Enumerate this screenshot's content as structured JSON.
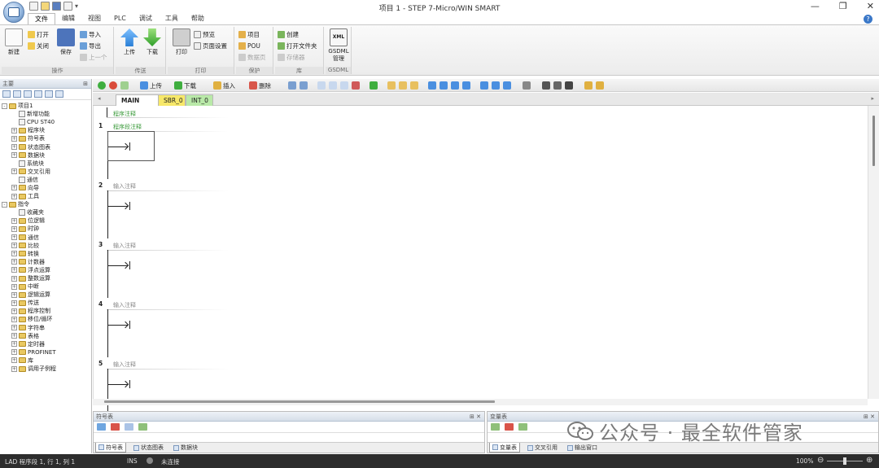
{
  "window": {
    "title": "项目 1 - STEP 7-Micro/WIN SMART",
    "controls": [
      "—",
      "❐",
      "✕"
    ]
  },
  "ribbon_tabs": [
    "文件",
    "编辑",
    "视图",
    "PLC",
    "调试",
    "工具",
    "帮助"
  ],
  "ribbon": {
    "groups": [
      {
        "label": "操作",
        "new": "新建",
        "open": "打开",
        "close": "关闭",
        "save": "保存",
        "import": "导入",
        "export": "导出",
        "recent": "上一个"
      },
      {
        "label": "传送",
        "upload": "上传",
        "download": "下载"
      },
      {
        "label": "打印",
        "print": "打印",
        "preview": "预览",
        "page_setup": "页面设置"
      },
      {
        "label": "保护",
        "project": "项目",
        "pou": "POU",
        "data_page": "数据页"
      },
      {
        "label": "库",
        "create": "创建",
        "open_folder": "打开文件夹",
        "memory": "存储器"
      },
      {
        "label": "GSDML",
        "xml_badge": "XML",
        "gsdml_manage": "GSDML管理"
      }
    ]
  },
  "left_pane": {
    "title": "主要"
  },
  "tree": [
    {
      "label": "项目1",
      "level": 0,
      "exp": "-"
    },
    {
      "label": "新增功能",
      "level": 1,
      "exp": ""
    },
    {
      "label": "CPU ST40",
      "level": 1,
      "exp": ""
    },
    {
      "label": "程序块",
      "level": 1,
      "exp": "+"
    },
    {
      "label": "符号表",
      "level": 1,
      "exp": "+"
    },
    {
      "label": "状态图表",
      "level": 1,
      "exp": "+"
    },
    {
      "label": "数据块",
      "level": 1,
      "exp": "+"
    },
    {
      "label": "系统块",
      "level": 1,
      "exp": ""
    },
    {
      "label": "交叉引用",
      "level": 1,
      "exp": "+"
    },
    {
      "label": "通信",
      "level": 1,
      "exp": ""
    },
    {
      "label": "向导",
      "level": 1,
      "exp": "+"
    },
    {
      "label": "工具",
      "level": 1,
      "exp": "+"
    },
    {
      "label": "指令",
      "level": 0,
      "exp": "-"
    },
    {
      "label": "收藏夹",
      "level": 1,
      "exp": ""
    },
    {
      "label": "位逻辑",
      "level": 1,
      "exp": "+"
    },
    {
      "label": "时钟",
      "level": 1,
      "exp": "+"
    },
    {
      "label": "通信",
      "level": 1,
      "exp": "+"
    },
    {
      "label": "比较",
      "level": 1,
      "exp": "+"
    },
    {
      "label": "转换",
      "level": 1,
      "exp": "+"
    },
    {
      "label": "计数器",
      "level": 1,
      "exp": "+"
    },
    {
      "label": "浮点运算",
      "level": 1,
      "exp": "+"
    },
    {
      "label": "整数运算",
      "level": 1,
      "exp": "+"
    },
    {
      "label": "中断",
      "level": 1,
      "exp": "+"
    },
    {
      "label": "逻辑运算",
      "level": 1,
      "exp": "+"
    },
    {
      "label": "传送",
      "level": 1,
      "exp": "+"
    },
    {
      "label": "程序控制",
      "level": 1,
      "exp": "+"
    },
    {
      "label": "移位/循环",
      "level": 1,
      "exp": "+"
    },
    {
      "label": "字符串",
      "level": 1,
      "exp": "+"
    },
    {
      "label": "表格",
      "level": 1,
      "exp": "+"
    },
    {
      "label": "定时器",
      "level": 1,
      "exp": "+"
    },
    {
      "label": "PROFINET",
      "level": 1,
      "exp": "+"
    },
    {
      "label": "库",
      "level": 1,
      "exp": "+"
    },
    {
      "label": "调用子例程",
      "level": 1,
      "exp": "+"
    }
  ],
  "editor_toolbar": {
    "upload": "上传",
    "download": "下载",
    "insert": "插入",
    "delete": "删除"
  },
  "sheet_tabs": [
    {
      "label": "MAIN",
      "active": true,
      "closable": true
    },
    {
      "label": "SBR_0",
      "active": false
    },
    {
      "label": "INT_0",
      "active": false
    }
  ],
  "program_comment": "程序注释",
  "networks": [
    {
      "number": "1",
      "comment": "程序段注释"
    },
    {
      "number": "2",
      "comment": "输入注释"
    },
    {
      "number": "3",
      "comment": "输入注释"
    },
    {
      "number": "4",
      "comment": "输入注释"
    },
    {
      "number": "5",
      "comment": "输入注释"
    }
  ],
  "symbol_pane": {
    "title": "符号表",
    "tabs": [
      "符号表",
      "状态图表",
      "数据块"
    ]
  },
  "variable_pane": {
    "title": "变量表",
    "tabs": [
      "变量表",
      "交叉引用",
      "输出窗口"
    ]
  },
  "watermark": "公众号 · 最全软件管家",
  "status": {
    "location": "LAD 程序段 1, 行 1, 列 1",
    "mode": "INS",
    "connection": "未连接",
    "zoom": "100%"
  }
}
